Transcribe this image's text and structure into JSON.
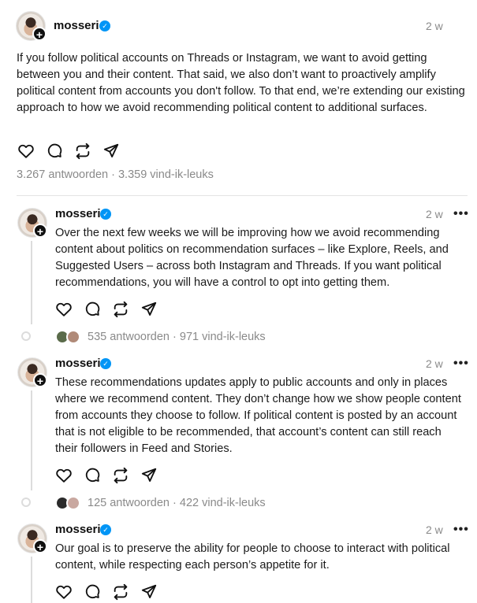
{
  "posts": [
    {
      "username": "mosseri",
      "time": "2 w",
      "text": "If you follow political accounts on Threads or Instagram, we want to avoid getting between you and their content. That said, we also don’t want to proactively amplify political content from accounts you don't follow. To that end, we’re extending our existing approach to how we avoid recommending political content to additional surfaces.",
      "stats": "3.267 antwoorden · 3.359 vind-ik-leuks"
    },
    {
      "username": "mosseri",
      "time": "2 w",
      "text": "Over the next few weeks we will be improving how we avoid recommending content about politics on recommendation surfaces – like Explore, Reels, and Suggested Users – across both Instagram and Threads. If you want political recommendations, you will have a control to opt into getting them.",
      "stats": "535 antwoorden · 971 vind-ik-leuks"
    },
    {
      "username": "mosseri",
      "time": "2 w",
      "text": "These recommendations updates apply to public accounts and only in places where we recommend content. They don’t change how we show people content from accounts they choose to follow. If political content is posted by an account that is not eligible to be recommended, that account’s content can still reach their followers in Feed and Stories.",
      "stats": "125 antwoorden · 422 vind-ik-leuks"
    },
    {
      "username": "mosseri",
      "time": "2 w",
      "text": "Our goal is to preserve the ability for people to choose to interact with political content, while respecting each person’s appetite for it."
    }
  ],
  "icons": {
    "follow": "+",
    "verified": "✓",
    "more": "•••"
  },
  "colors": {
    "verified": "#0095f6",
    "muted": "#8a8a8a",
    "text": "#101010"
  }
}
